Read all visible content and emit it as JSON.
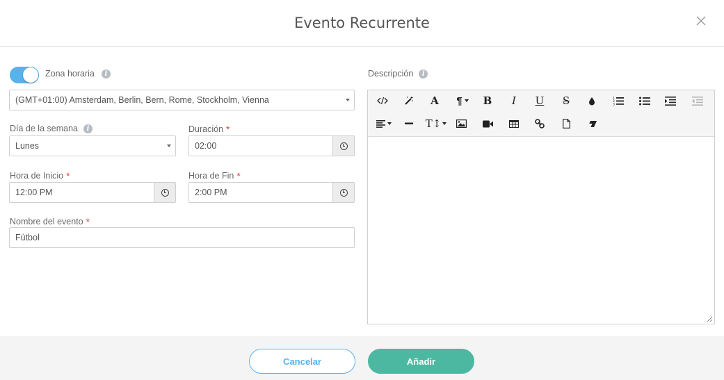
{
  "dialog": {
    "title": "Evento Recurrente"
  },
  "timezone": {
    "toggle_on": true,
    "label": "Zona horaria",
    "value": "(GMT+01:00) Amsterdam, Berlin, Bern, Rome, Stockholm, Vienna"
  },
  "weekday": {
    "label": "Día de la semana",
    "value": "Lunes"
  },
  "duration": {
    "label": "Duración",
    "value": "02:00"
  },
  "start_time": {
    "label": "Hora de Inicio",
    "value": "12:00 PM"
  },
  "end_time": {
    "label": "Hora de Fin",
    "value": "2:00 PM"
  },
  "event_name": {
    "label": "Nombre del evento",
    "value": "Fútbol"
  },
  "description": {
    "label": "Descripción",
    "value": ""
  },
  "required_mark": "*",
  "info_glyph": "i",
  "toolbar": {
    "bold": "B",
    "italic": "I",
    "underline": "U",
    "strike": "S",
    "font": "A",
    "paragraph": "¶",
    "text_height": "T↕",
    "icons": [
      "code-view-icon",
      "magic-wand-icon",
      "font-icon",
      "paragraph-icon",
      "bold-icon",
      "italic-icon",
      "underline-icon",
      "strikethrough-icon",
      "color-drop-icon",
      "ordered-list-icon",
      "unordered-list-icon",
      "indent-icon",
      "outdent-icon",
      "align-icon",
      "horizontal-rule-icon",
      "line-height-icon",
      "image-icon",
      "video-icon",
      "table-icon",
      "link-icon",
      "file-icon",
      "eraser-icon"
    ]
  },
  "footer": {
    "cancel_label": "Cancelar",
    "add_label": "Añadir"
  },
  "colors": {
    "accent_blue": "#58b3ec",
    "add_green": "#4db8a1",
    "required_red": "#e04545"
  }
}
